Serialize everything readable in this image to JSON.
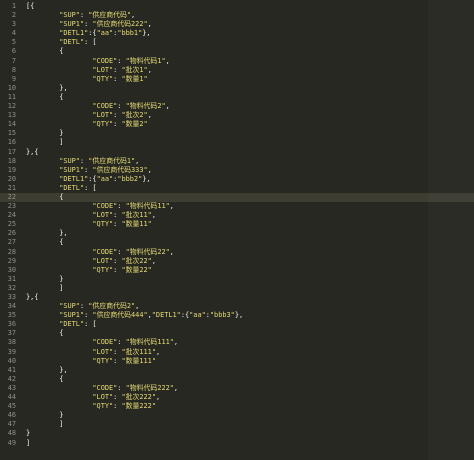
{
  "editor": {
    "lines": [
      {
        "n": "1",
        "segments": [
          {
            "t": "[{",
            "k": "p"
          }
        ]
      },
      {
        "n": "2",
        "segments": [
          {
            "t": "        ",
            "k": "p"
          },
          {
            "t": "\"SUP\"",
            "k": "s"
          },
          {
            "t": ": ",
            "k": "p"
          },
          {
            "t": "\"供应商代码\"",
            "k": "s"
          },
          {
            "t": ",",
            "k": "p"
          }
        ]
      },
      {
        "n": "3",
        "segments": [
          {
            "t": "        ",
            "k": "p"
          },
          {
            "t": "\"SUP1\"",
            "k": "s"
          },
          {
            "t": ": ",
            "k": "p"
          },
          {
            "t": "\"供应商代码222\"",
            "k": "s"
          },
          {
            "t": ",",
            "k": "p"
          }
        ]
      },
      {
        "n": "4",
        "segments": [
          {
            "t": "        ",
            "k": "p"
          },
          {
            "t": "\"DETL1\"",
            "k": "s"
          },
          {
            "t": ":{",
            "k": "p"
          },
          {
            "t": "\"aa\"",
            "k": "s"
          },
          {
            "t": ":",
            "k": "p"
          },
          {
            "t": "\"bbb1\"",
            "k": "s"
          },
          {
            "t": "},",
            "k": "p"
          }
        ]
      },
      {
        "n": "5",
        "segments": [
          {
            "t": "        ",
            "k": "p"
          },
          {
            "t": "\"DETL\"",
            "k": "s"
          },
          {
            "t": ": [",
            "k": "p"
          }
        ]
      },
      {
        "n": "6",
        "segments": [
          {
            "t": "        {",
            "k": "p"
          }
        ]
      },
      {
        "n": "7",
        "segments": [
          {
            "t": "                ",
            "k": "p"
          },
          {
            "t": "\"CODE\"",
            "k": "s"
          },
          {
            "t": ": ",
            "k": "p"
          },
          {
            "t": "\"物料代码1\"",
            "k": "s"
          },
          {
            "t": ",",
            "k": "p"
          }
        ]
      },
      {
        "n": "8",
        "segments": [
          {
            "t": "                ",
            "k": "p"
          },
          {
            "t": "\"LOT\"",
            "k": "s"
          },
          {
            "t": ": ",
            "k": "p"
          },
          {
            "t": "\"批次1\"",
            "k": "s"
          },
          {
            "t": ",",
            "k": "p"
          }
        ]
      },
      {
        "n": "9",
        "segments": [
          {
            "t": "                ",
            "k": "p"
          },
          {
            "t": "\"QTY\"",
            "k": "s"
          },
          {
            "t": ": ",
            "k": "p"
          },
          {
            "t": "\"数量1\"",
            "k": "s"
          }
        ]
      },
      {
        "n": "10",
        "segments": [
          {
            "t": "        },",
            "k": "p"
          }
        ]
      },
      {
        "n": "11",
        "segments": [
          {
            "t": "        {",
            "k": "p"
          }
        ]
      },
      {
        "n": "12",
        "segments": [
          {
            "t": "                ",
            "k": "p"
          },
          {
            "t": "\"CODE\"",
            "k": "s"
          },
          {
            "t": ": ",
            "k": "p"
          },
          {
            "t": "\"物料代码2\"",
            "k": "s"
          },
          {
            "t": ",",
            "k": "p"
          }
        ]
      },
      {
        "n": "13",
        "segments": [
          {
            "t": "                ",
            "k": "p"
          },
          {
            "t": "\"LOT\"",
            "k": "s"
          },
          {
            "t": ": ",
            "k": "p"
          },
          {
            "t": "\"批次2\"",
            "k": "s"
          },
          {
            "t": ",",
            "k": "p"
          }
        ]
      },
      {
        "n": "14",
        "segments": [
          {
            "t": "                ",
            "k": "p"
          },
          {
            "t": "\"QTY\"",
            "k": "s"
          },
          {
            "t": ": ",
            "k": "p"
          },
          {
            "t": "\"数量2\"",
            "k": "s"
          }
        ]
      },
      {
        "n": "15",
        "segments": [
          {
            "t": "        }",
            "k": "p"
          }
        ]
      },
      {
        "n": "16",
        "segments": [
          {
            "t": "        ]",
            "k": "p"
          }
        ]
      },
      {
        "n": "17",
        "segments": [
          {
            "t": "},{",
            "k": "p"
          }
        ]
      },
      {
        "n": "18",
        "segments": [
          {
            "t": "        ",
            "k": "p"
          },
          {
            "t": "\"SUP\"",
            "k": "s"
          },
          {
            "t": ": ",
            "k": "p"
          },
          {
            "t": "\"供应商代码1\"",
            "k": "s"
          },
          {
            "t": ",",
            "k": "p"
          }
        ]
      },
      {
        "n": "19",
        "segments": [
          {
            "t": "        ",
            "k": "p"
          },
          {
            "t": "\"SUP1\"",
            "k": "s"
          },
          {
            "t": ": ",
            "k": "p"
          },
          {
            "t": "\"供应商代码333\"",
            "k": "s"
          },
          {
            "t": ",",
            "k": "p"
          }
        ]
      },
      {
        "n": "20",
        "segments": [
          {
            "t": "        ",
            "k": "p"
          },
          {
            "t": "\"DETL1\"",
            "k": "s"
          },
          {
            "t": ":{",
            "k": "p"
          },
          {
            "t": "\"aa\"",
            "k": "s"
          },
          {
            "t": ":",
            "k": "p"
          },
          {
            "t": "\"bbb2\"",
            "k": "s"
          },
          {
            "t": "},",
            "k": "p"
          }
        ]
      },
      {
        "n": "21",
        "segments": [
          {
            "t": "        ",
            "k": "p"
          },
          {
            "t": "\"DETL\"",
            "k": "s"
          },
          {
            "t": ": [",
            "k": "p"
          }
        ]
      },
      {
        "n": "22",
        "active": true,
        "segments": [
          {
            "t": "        {",
            "k": "p"
          }
        ]
      },
      {
        "n": "23",
        "segments": [
          {
            "t": "                ",
            "k": "p"
          },
          {
            "t": "\"CODE\"",
            "k": "s"
          },
          {
            "t": ": ",
            "k": "p"
          },
          {
            "t": "\"物料代码11\"",
            "k": "s"
          },
          {
            "t": ",",
            "k": "p"
          }
        ]
      },
      {
        "n": "24",
        "segments": [
          {
            "t": "                ",
            "k": "p"
          },
          {
            "t": "\"LOT\"",
            "k": "s"
          },
          {
            "t": ": ",
            "k": "p"
          },
          {
            "t": "\"批次11\"",
            "k": "s"
          },
          {
            "t": ",",
            "k": "p"
          }
        ]
      },
      {
        "n": "25",
        "segments": [
          {
            "t": "                ",
            "k": "p"
          },
          {
            "t": "\"QTY\"",
            "k": "s"
          },
          {
            "t": ": ",
            "k": "p"
          },
          {
            "t": "\"数量11\"",
            "k": "s"
          }
        ]
      },
      {
        "n": "26",
        "segments": [
          {
            "t": "        },",
            "k": "p"
          }
        ]
      },
      {
        "n": "27",
        "segments": [
          {
            "t": "        {",
            "k": "p"
          }
        ]
      },
      {
        "n": "28",
        "segments": [
          {
            "t": "                ",
            "k": "p"
          },
          {
            "t": "\"CODE\"",
            "k": "s"
          },
          {
            "t": ": ",
            "k": "p"
          },
          {
            "t": "\"物料代码22\"",
            "k": "s"
          },
          {
            "t": ",",
            "k": "p"
          }
        ]
      },
      {
        "n": "29",
        "segments": [
          {
            "t": "                ",
            "k": "p"
          },
          {
            "t": "\"LOT\"",
            "k": "s"
          },
          {
            "t": ": ",
            "k": "p"
          },
          {
            "t": "\"批次22\"",
            "k": "s"
          },
          {
            "t": ",",
            "k": "p"
          }
        ]
      },
      {
        "n": "30",
        "segments": [
          {
            "t": "                ",
            "k": "p"
          },
          {
            "t": "\"QTY\"",
            "k": "s"
          },
          {
            "t": ": ",
            "k": "p"
          },
          {
            "t": "\"数量22\"",
            "k": "s"
          }
        ]
      },
      {
        "n": "31",
        "segments": [
          {
            "t": "        }",
            "k": "p"
          }
        ]
      },
      {
        "n": "32",
        "segments": [
          {
            "t": "        ]",
            "k": "p"
          }
        ]
      },
      {
        "n": "33",
        "segments": [
          {
            "t": "},{",
            "k": "p"
          }
        ]
      },
      {
        "n": "34",
        "segments": [
          {
            "t": "        ",
            "k": "p"
          },
          {
            "t": "\"SUP\"",
            "k": "s"
          },
          {
            "t": ": ",
            "k": "p"
          },
          {
            "t": "\"供应商代码2\"",
            "k": "s"
          },
          {
            "t": ",",
            "k": "p"
          }
        ]
      },
      {
        "n": "35",
        "segments": [
          {
            "t": "        ",
            "k": "p"
          },
          {
            "t": "\"SUP1\"",
            "k": "s"
          },
          {
            "t": ": ",
            "k": "p"
          },
          {
            "t": "\"供应商代码444\"",
            "k": "s"
          },
          {
            "t": ",",
            "k": "p"
          },
          {
            "t": "\"DETL1\"",
            "k": "s"
          },
          {
            "t": ":{",
            "k": "p"
          },
          {
            "t": "\"aa\"",
            "k": "s"
          },
          {
            "t": ":",
            "k": "p"
          },
          {
            "t": "\"bbb3\"",
            "k": "s"
          },
          {
            "t": "},",
            "k": "p"
          }
        ]
      },
      {
        "n": "36",
        "segments": [
          {
            "t": "        ",
            "k": "p"
          },
          {
            "t": "\"DETL\"",
            "k": "s"
          },
          {
            "t": ": [",
            "k": "p"
          }
        ]
      },
      {
        "n": "37",
        "segments": [
          {
            "t": "        {",
            "k": "p"
          }
        ]
      },
      {
        "n": "38",
        "segments": [
          {
            "t": "                ",
            "k": "p"
          },
          {
            "t": "\"CODE\"",
            "k": "s"
          },
          {
            "t": ": ",
            "k": "p"
          },
          {
            "t": "\"物料代码111\"",
            "k": "s"
          },
          {
            "t": ",",
            "k": "p"
          }
        ]
      },
      {
        "n": "39",
        "segments": [
          {
            "t": "                ",
            "k": "p"
          },
          {
            "t": "\"LOT\"",
            "k": "s"
          },
          {
            "t": ": ",
            "k": "p"
          },
          {
            "t": "\"批次111\"",
            "k": "s"
          },
          {
            "t": ",",
            "k": "p"
          }
        ]
      },
      {
        "n": "40",
        "segments": [
          {
            "t": "                ",
            "k": "p"
          },
          {
            "t": "\"QTY\"",
            "k": "s"
          },
          {
            "t": ": ",
            "k": "p"
          },
          {
            "t": "\"数量111\"",
            "k": "s"
          }
        ]
      },
      {
        "n": "41",
        "segments": [
          {
            "t": "        },",
            "k": "p"
          }
        ]
      },
      {
        "n": "42",
        "segments": [
          {
            "t": "        {",
            "k": "p"
          }
        ]
      },
      {
        "n": "43",
        "segments": [
          {
            "t": "                ",
            "k": "p"
          },
          {
            "t": "\"CODE\"",
            "k": "s"
          },
          {
            "t": ": ",
            "k": "p"
          },
          {
            "t": "\"物料代码222\"",
            "k": "s"
          },
          {
            "t": ",",
            "k": "p"
          }
        ]
      },
      {
        "n": "44",
        "segments": [
          {
            "t": "                ",
            "k": "p"
          },
          {
            "t": "\"LOT\"",
            "k": "s"
          },
          {
            "t": ": ",
            "k": "p"
          },
          {
            "t": "\"批次222\"",
            "k": "s"
          },
          {
            "t": ",",
            "k": "p"
          }
        ]
      },
      {
        "n": "45",
        "segments": [
          {
            "t": "                ",
            "k": "p"
          },
          {
            "t": "\"QTY\"",
            "k": "s"
          },
          {
            "t": ": ",
            "k": "p"
          },
          {
            "t": "\"数量222\"",
            "k": "s"
          }
        ]
      },
      {
        "n": "46",
        "segments": [
          {
            "t": "        }",
            "k": "p"
          }
        ]
      },
      {
        "n": "47",
        "segments": [
          {
            "t": "        ]",
            "k": "p"
          }
        ]
      },
      {
        "n": "48",
        "segments": [
          {
            "t": "}",
            "k": "p"
          }
        ]
      },
      {
        "n": "49",
        "segments": [
          {
            "t": "]",
            "k": "p"
          }
        ]
      }
    ]
  },
  "colors": {
    "background": "#272822",
    "line_number": "#8f908a",
    "string": "#e6db74",
    "punctuation": "#f8f8f2",
    "active_line": "#3e3d32"
  }
}
